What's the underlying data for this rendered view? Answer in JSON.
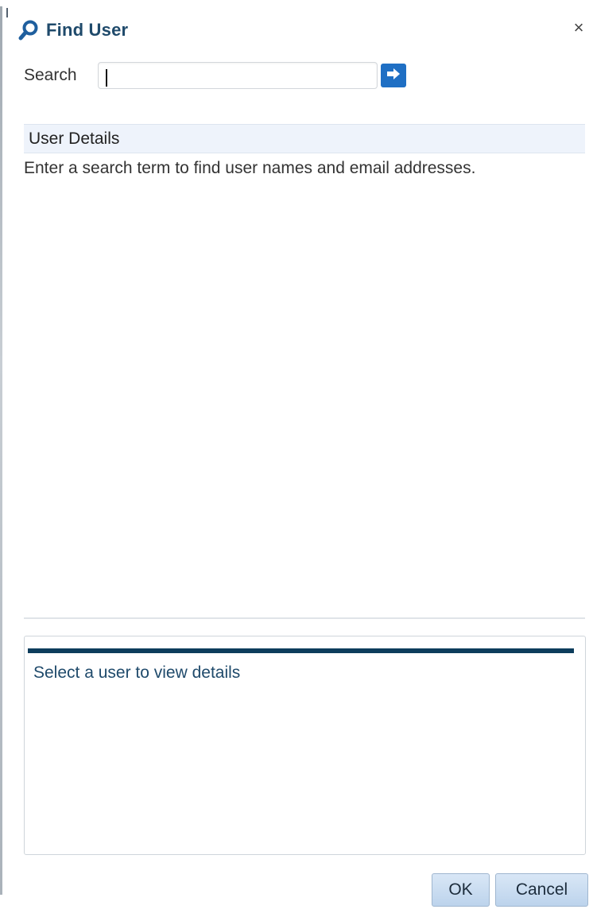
{
  "dialog": {
    "title": "Find User",
    "close_label": "×"
  },
  "search": {
    "label": "Search",
    "value": "",
    "placeholder": ""
  },
  "results": {
    "column_header": "User Details",
    "empty_message": "Enter a search term to find user names and email addresses."
  },
  "details": {
    "placeholder": "Select a user to view details"
  },
  "buttons": {
    "ok": "OK",
    "cancel": "Cancel"
  },
  "colors": {
    "title": "#1f4a6b",
    "accent": "#1f6fc4",
    "details_bar": "#0d3d5c"
  },
  "icons": {
    "title": "magnifier-icon",
    "go": "arrow-right-icon",
    "close": "close-icon"
  }
}
